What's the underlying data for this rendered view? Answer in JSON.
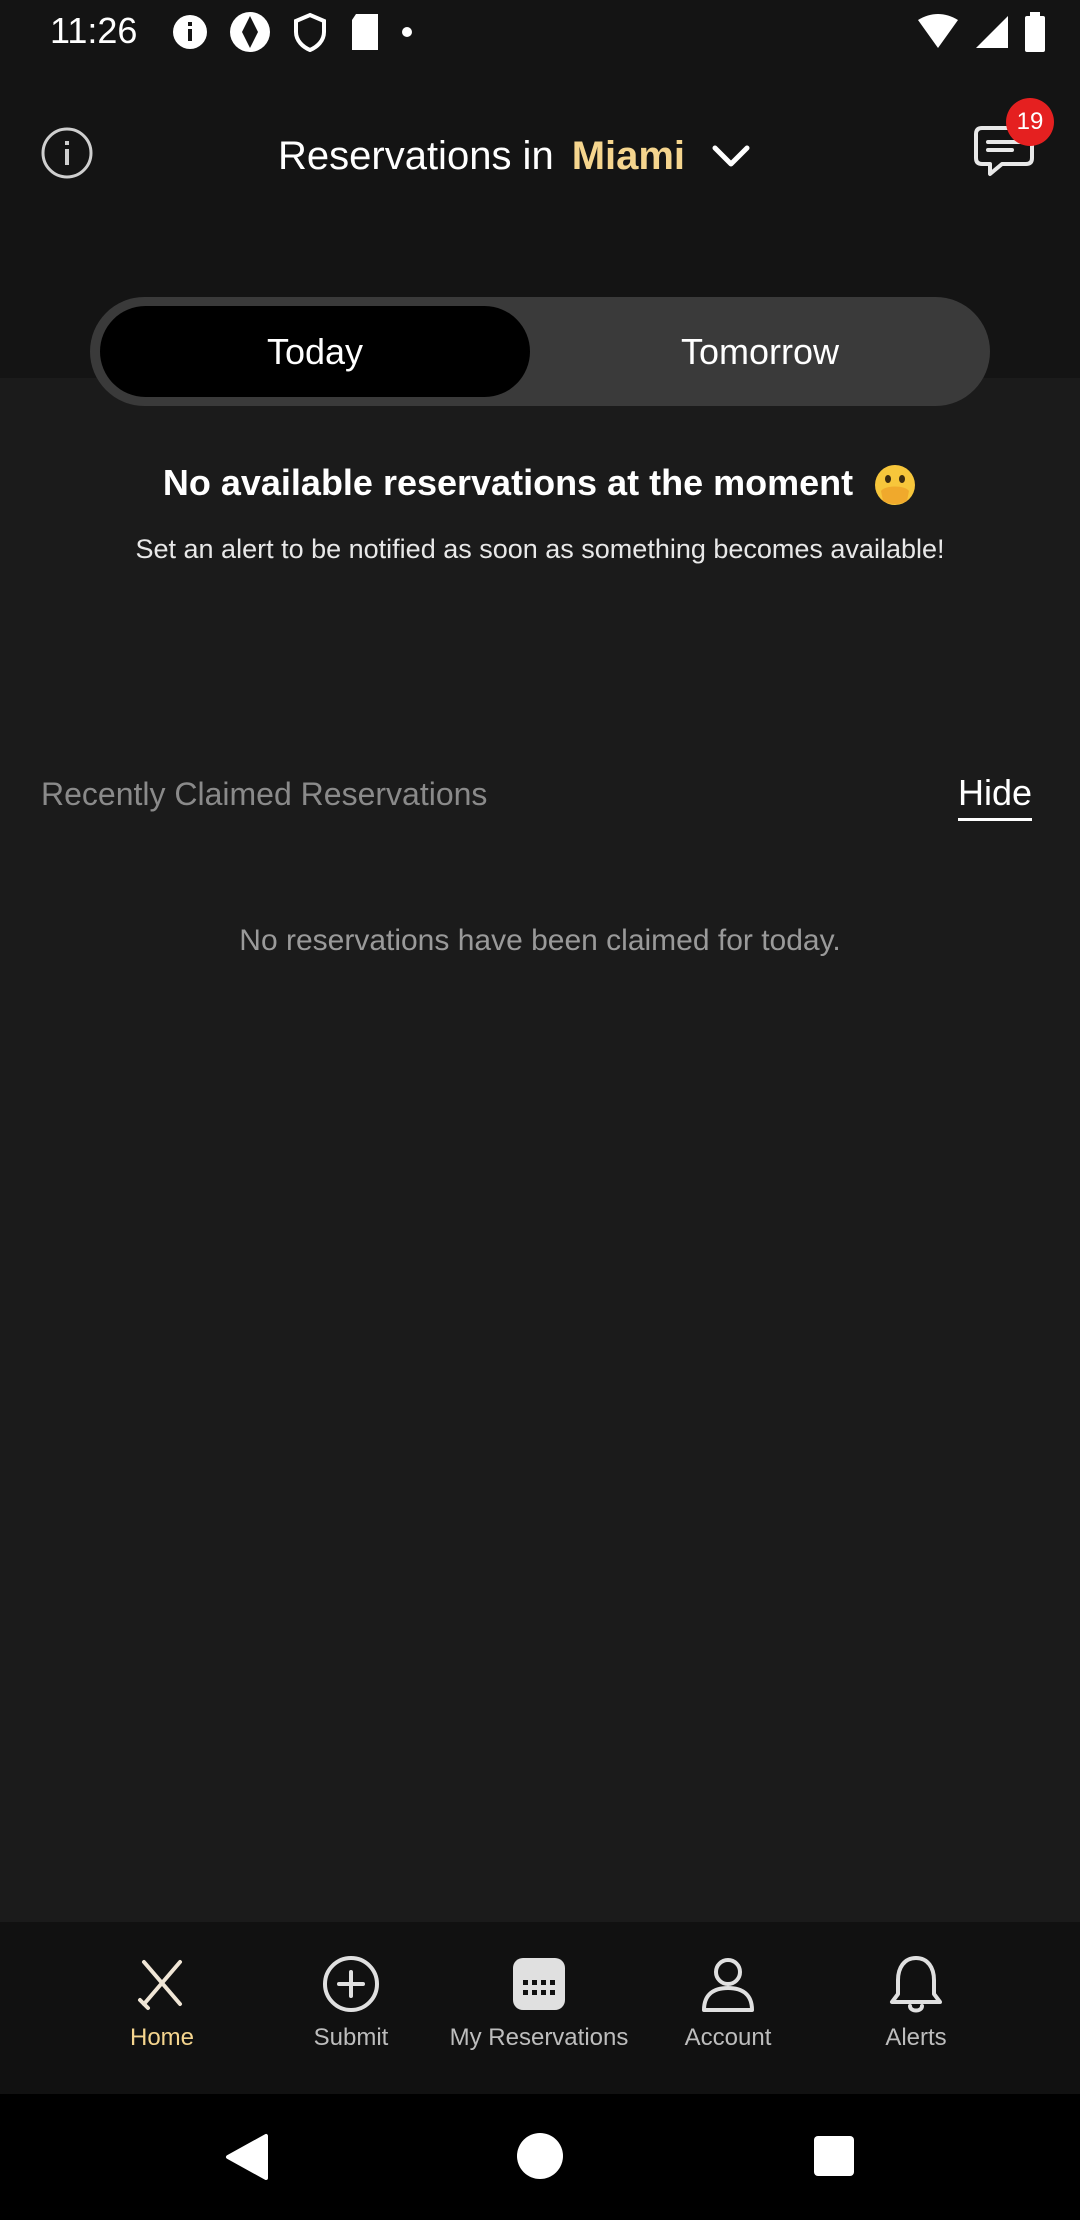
{
  "status_bar": {
    "time": "11:26"
  },
  "header": {
    "title": "Reservations in",
    "city": "Miami",
    "chat_badge_count": "19"
  },
  "day_toggle": {
    "options": [
      "Today",
      "Tomorrow"
    ],
    "selected": "Today"
  },
  "empty_state": {
    "title": "No available reservations at the moment",
    "subtitle": "Set an alert to be notified as soon as something becomes available!"
  },
  "recently_claimed": {
    "label": "Recently Claimed Reservations",
    "toggle_label": "Hide",
    "empty_text": "No reservations have been claimed for today."
  },
  "bottom_nav": {
    "items": [
      {
        "label": "Home",
        "icon": "crossed-utensils-icon",
        "active": true
      },
      {
        "label": "Submit",
        "icon": "plus-circle-icon",
        "active": false
      },
      {
        "label": "My Reservations",
        "icon": "calendar-icon",
        "active": false
      },
      {
        "label": "Account",
        "icon": "person-icon",
        "active": false
      },
      {
        "label": "Alerts",
        "icon": "bell-icon",
        "active": false
      }
    ]
  },
  "colors": {
    "accent": "#f5d58e",
    "background": "#1b1b1b",
    "badge": "#e52020"
  }
}
